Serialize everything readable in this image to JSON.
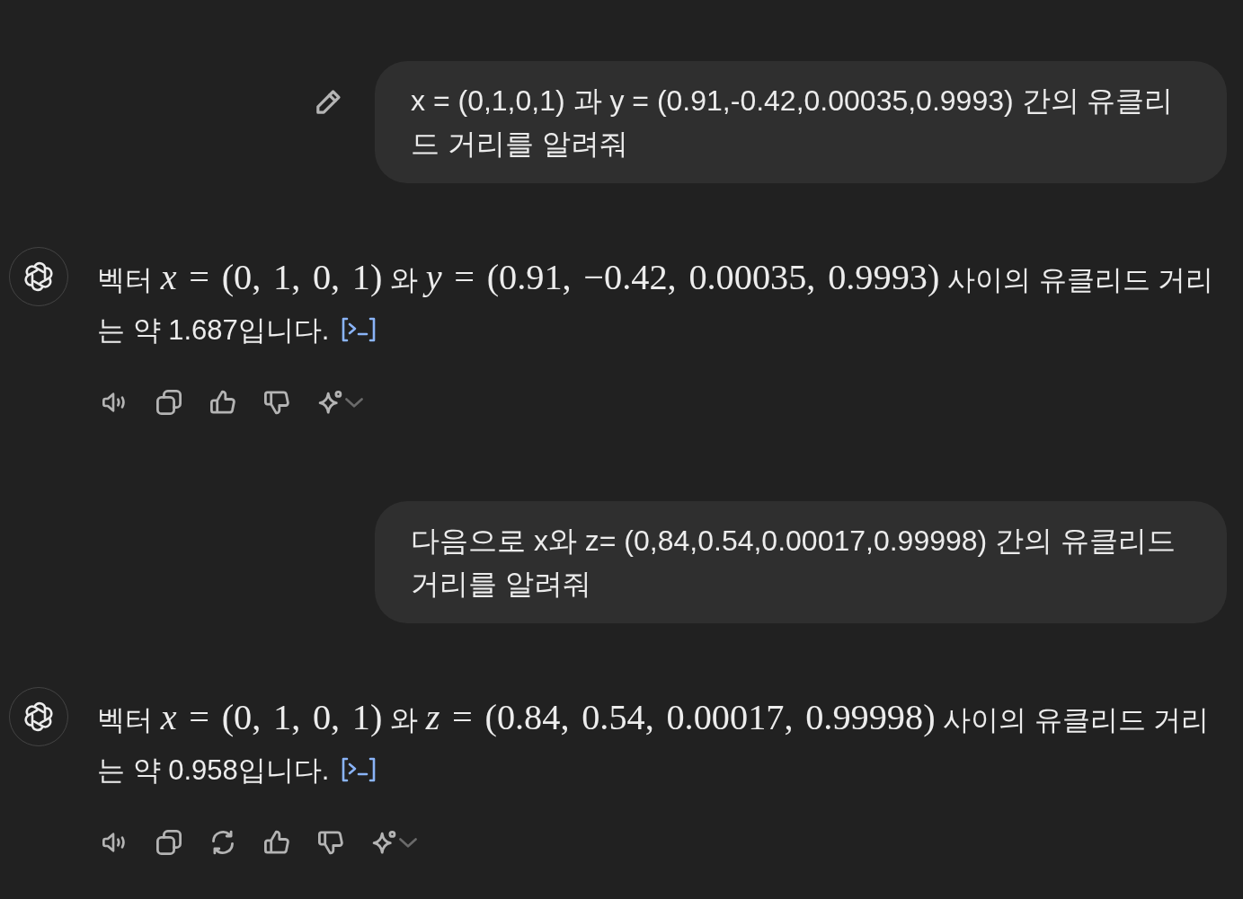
{
  "messages": [
    {
      "kind": "user",
      "edit_button": true,
      "text": "x = (0,1,0,1) 과 y = (0.91,-0.42,0.00035,0.9993) 간의 유클리드 거리를 알려줘"
    },
    {
      "kind": "assistant",
      "segments": [
        {
          "kind": "text",
          "text": "벡터 "
        },
        {
          "kind": "math",
          "text": "*x* = (0, 1, 0, 1)"
        },
        {
          "kind": "text",
          "text": " 와 "
        },
        {
          "kind": "math",
          "text": "*y* = (0.91, −0.42, 0.00035, 0.9993)"
        },
        {
          "kind": "text",
          "text": " 사이의 유클리드 거리는 약 1.687입니다. "
        },
        {
          "kind": "code_link"
        }
      ],
      "actions": [
        {
          "kind": "read_aloud"
        },
        {
          "kind": "copy"
        },
        {
          "kind": "thumbs_up"
        },
        {
          "kind": "thumbs_down"
        },
        {
          "kind": "model_switch"
        }
      ]
    },
    {
      "kind": "user",
      "edit_button": false,
      "text": "다음으로 x와 z= (0,84,0.54,0.00017,0.99998) 간의 유클리드 거리를 알려줘"
    },
    {
      "kind": "assistant",
      "segments": [
        {
          "kind": "text",
          "text": "벡터 "
        },
        {
          "kind": "math",
          "text": "*x* = (0, 1, 0, 1)"
        },
        {
          "kind": "text",
          "text": " 와 "
        },
        {
          "kind": "math",
          "text": "*z* = (0.84, 0.54, 0.00017, 0.99998)"
        },
        {
          "kind": "text",
          "text": " 사이의 유클리드 거리는 약 0.958입니다. "
        },
        {
          "kind": "code_link"
        }
      ],
      "actions": [
        {
          "kind": "read_aloud"
        },
        {
          "kind": "copy"
        },
        {
          "kind": "regenerate"
        },
        {
          "kind": "thumbs_up"
        },
        {
          "kind": "thumbs_down"
        },
        {
          "kind": "model_switch"
        }
      ]
    }
  ]
}
